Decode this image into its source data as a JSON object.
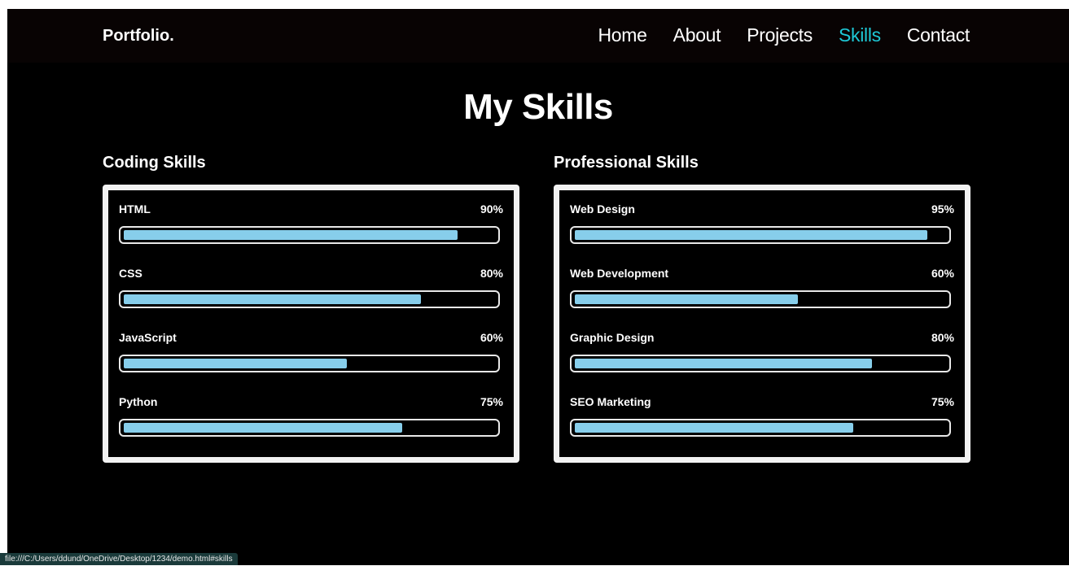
{
  "nav": {
    "logo": "Portfolio.",
    "links": [
      {
        "label": "Home",
        "active": false
      },
      {
        "label": "About",
        "active": false
      },
      {
        "label": "Projects",
        "active": false
      },
      {
        "label": "Skills",
        "active": true
      },
      {
        "label": "Contact",
        "active": false
      }
    ]
  },
  "page_title": "My Skills",
  "coding": {
    "heading": "Coding Skills",
    "skills": [
      {
        "name": "HTML",
        "percent": "90%",
        "level": 0.9
      },
      {
        "name": "CSS",
        "percent": "80%",
        "level": 0.8
      },
      {
        "name": "JavaScript",
        "percent": "60%",
        "level": 0.6
      },
      {
        "name": "Python",
        "percent": "75%",
        "level": 0.75
      }
    ]
  },
  "professional": {
    "heading": "Professional Skills",
    "skills": [
      {
        "name": "Web Design",
        "percent": "95%",
        "level": 0.95
      },
      {
        "name": "Web Development",
        "percent": "60%",
        "level": 0.6
      },
      {
        "name": "Graphic Design",
        "percent": "80%",
        "level": 0.8
      },
      {
        "name": "SEO Marketing",
        "percent": "75%",
        "level": 0.75
      }
    ]
  },
  "colors": {
    "accent": "#1ec8d6",
    "bar_fill": "#87ceeb",
    "background": "#000000"
  },
  "status_bar": {
    "url": "file:///C:/Users/ddund/OneDrive/Desktop/1234/demo.html#skills"
  }
}
